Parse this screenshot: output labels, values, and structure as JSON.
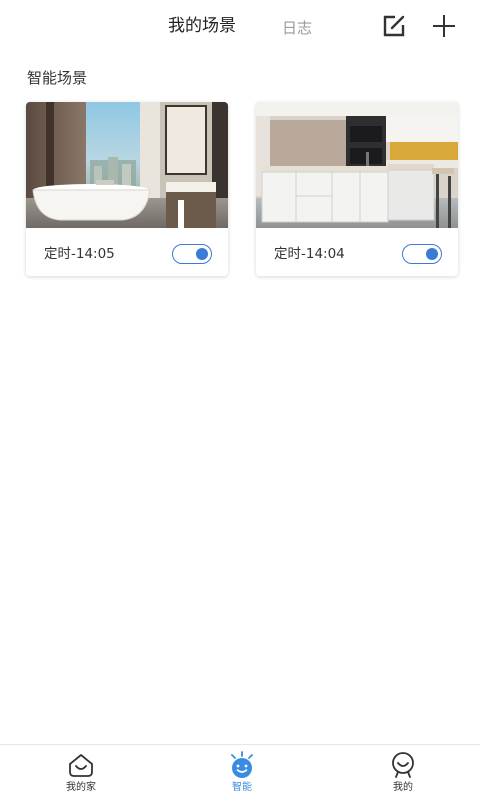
{
  "header": {
    "tab_scenes": "我的场景",
    "tab_log": "日志",
    "edit_icon": "edit-square-icon",
    "add_icon": "plus-icon"
  },
  "section": {
    "title": "智能场景"
  },
  "scenes": [
    {
      "label": "定时-14:05",
      "image": "bathroom-photo",
      "enabled": true
    },
    {
      "label": "定时-14:04",
      "image": "kitchen-photo",
      "enabled": true
    }
  ],
  "nav": {
    "items": [
      {
        "label": "我的家",
        "icon": "home-face-icon",
        "active": false
      },
      {
        "label": "智能",
        "icon": "smart-robot-icon",
        "active": true
      },
      {
        "label": "我的",
        "icon": "profile-face-icon",
        "active": false
      }
    ]
  },
  "colors": {
    "accent": "#3a7bd5",
    "active_nav": "#3a8ce0",
    "text": "#333333",
    "muted": "#9a9a9a"
  }
}
